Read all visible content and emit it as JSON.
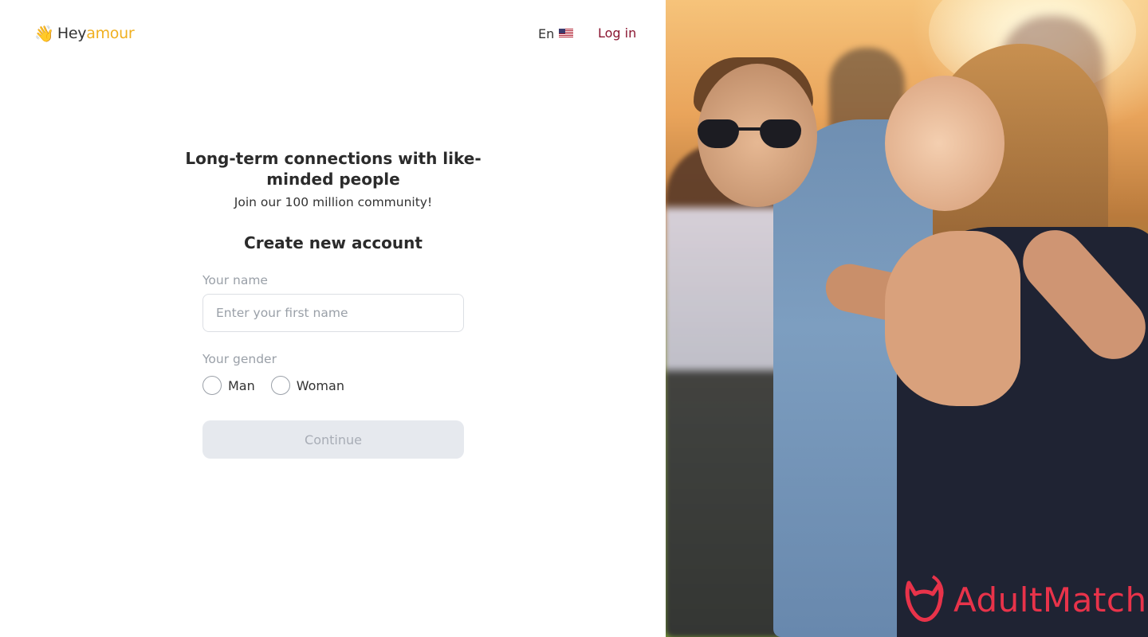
{
  "brand": {
    "wave_icon": "waving-hand-icon",
    "name_part1": "Hey",
    "name_part2": "amour",
    "accent_color": "#f0b020"
  },
  "nav": {
    "language": "En",
    "flag_icon": "us-flag-icon",
    "login": "Log in",
    "login_color": "#8a1530"
  },
  "form": {
    "headline": "Long-term connections with like-minded people",
    "subheadline": "Join our 100 million community!",
    "title": "Create new account",
    "name_label": "Your name",
    "name_placeholder": "Enter your first name",
    "name_value": "",
    "gender_label": "Your gender",
    "gender_options": [
      "Man",
      "Woman"
    ],
    "continue": "Continue"
  },
  "watermark": {
    "icon": "devil-mask-icon",
    "text": "AdultMatch",
    "color": "#e8334a"
  }
}
